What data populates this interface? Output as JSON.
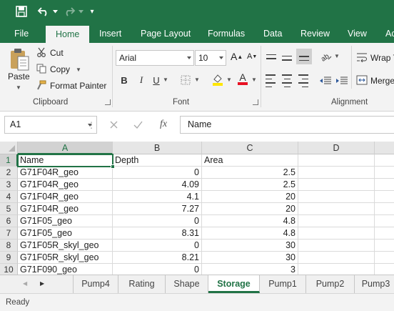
{
  "qat": {
    "customize_glyph": "▾"
  },
  "tabs": [
    "File",
    "Home",
    "Insert",
    "Page Layout",
    "Formulas",
    "Data",
    "Review",
    "View",
    "Ac"
  ],
  "ribbon": {
    "clipboard": {
      "paste": "Paste",
      "cut": "Cut",
      "copy": "Copy",
      "format_painter": "Format Painter",
      "label": "Clipboard"
    },
    "font": {
      "font_name": "Arial",
      "font_size": "10",
      "bold": "B",
      "italic": "I",
      "underline": "U",
      "font_color_letter": "A",
      "label": "Font",
      "fill_color": "#FFE600",
      "font_color": "#E81123"
    },
    "alignment": {
      "wrap_text": "Wrap T",
      "merge": "Merge",
      "label": "Alignment"
    }
  },
  "formula_bar": {
    "name_box": "A1",
    "fx": "fx",
    "value": "Name"
  },
  "grid": {
    "columns": [
      "A",
      "B",
      "C",
      "D"
    ],
    "rows": [
      {
        "num": "1",
        "a": "Name",
        "b": "Depth",
        "c": "Area"
      },
      {
        "num": "2",
        "a": "G71F04R_geo",
        "b": "0",
        "c": "2.5"
      },
      {
        "num": "3",
        "a": "G71F04R_geo",
        "b": "4.09",
        "c": "2.5"
      },
      {
        "num": "4",
        "a": "G71F04R_geo",
        "b": "4.1",
        "c": "20"
      },
      {
        "num": "5",
        "a": "G71F04R_geo",
        "b": "7.27",
        "c": "20"
      },
      {
        "num": "6",
        "a": "G71F05_geo",
        "b": "0",
        "c": "4.8"
      },
      {
        "num": "7",
        "a": "G71F05_geo",
        "b": "8.31",
        "c": "4.8"
      },
      {
        "num": "8",
        "a": "G71F05R_skyl_geo",
        "b": "0",
        "c": "30"
      },
      {
        "num": "9",
        "a": "G71F05R_skyl_geo",
        "b": "8.21",
        "c": "30"
      },
      {
        "num": "10",
        "a": "G71F090_geo",
        "b": "0",
        "c": "3"
      }
    ]
  },
  "sheets": [
    "Pump4",
    "Rating",
    "Shape",
    "Storage",
    "Pump1",
    "Pump2",
    "Pump3"
  ],
  "active_sheet": "Storage",
  "status": {
    "text": "Ready"
  },
  "colors": {
    "accent": "#217346"
  }
}
